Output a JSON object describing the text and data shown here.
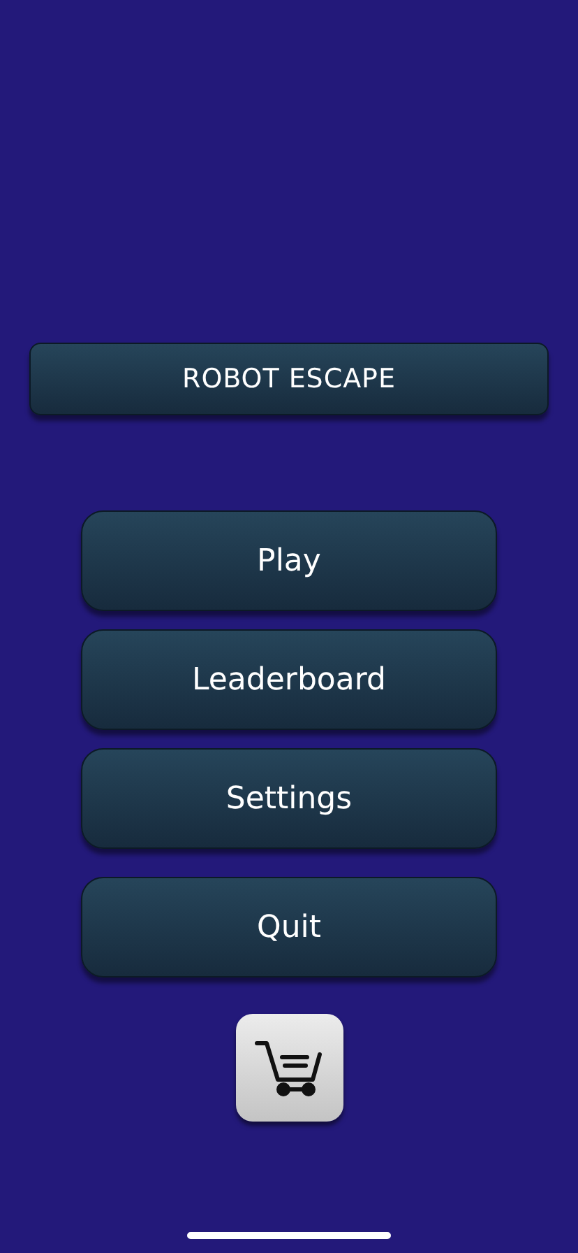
{
  "title": "ROBOT ESCAPE",
  "menu": [
    "Play",
    "Leaderboard",
    "Settings",
    "Quit"
  ],
  "shop": {
    "kind": "cart"
  }
}
